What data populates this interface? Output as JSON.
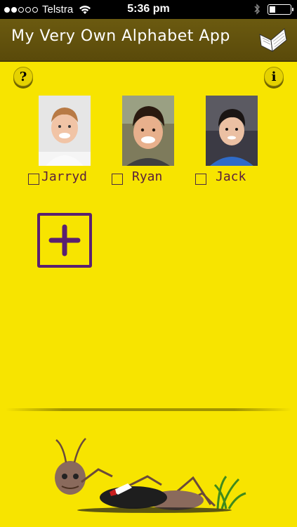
{
  "status_bar": {
    "carrier": "Telstra",
    "time": "5:36 pm",
    "signal_bars_filled": 2,
    "signal_bars_total": 5,
    "battery_level": 0.3
  },
  "header": {
    "title": "My Very Own Alphabet App",
    "icon": "open-book-icon"
  },
  "buttons": {
    "help_symbol": "?",
    "info_symbol": "i",
    "add_icon": "plus-icon"
  },
  "profiles": [
    {
      "name": "Jarryd",
      "checked": false
    },
    {
      "name": "Ryan",
      "checked": false
    },
    {
      "name": "Jack",
      "checked": false
    }
  ],
  "colors": {
    "background": "#f7e400",
    "header": "#5f4e0d",
    "label": "#5a1f3c",
    "add_button": "#5a2070"
  }
}
